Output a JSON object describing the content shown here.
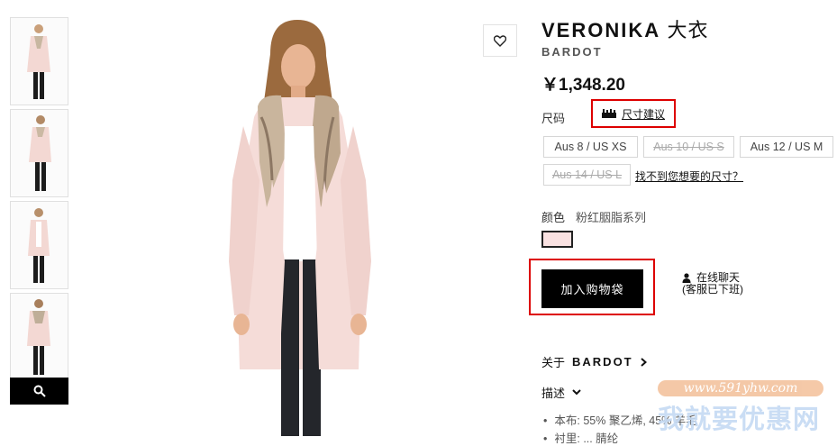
{
  "product": {
    "title_en": "VERONIKA",
    "title_cn": "大衣",
    "brand": "BARDOT",
    "price": "￥1,348.20"
  },
  "sizes": {
    "label": "尺码",
    "guide_label": "尺寸建议",
    "options": [
      {
        "label": "Aus 8 / US XS",
        "available": true
      },
      {
        "label": "Aus 10 / US S",
        "available": false
      },
      {
        "label": "Aus 12 / US M",
        "available": true
      },
      {
        "label": "Aus 14 / US L",
        "available": false
      }
    ],
    "find_size_link": "找不到您想要的尺寸？"
  },
  "color": {
    "label": "颜色",
    "value": "粉红胭脂系列",
    "swatch": "#f9e1e1"
  },
  "actions": {
    "add_to_bag": "加入购物袋",
    "chat_line1": "在线聊天",
    "chat_line2": "(客服已下班)"
  },
  "about": {
    "prefix": "关于",
    "brand": "BARDOT"
  },
  "description": {
    "label": "描述",
    "bullets": [
      "本布: 55% 聚乙烯, 45% 羊毛",
      "衬里: ... 腈纶"
    ]
  },
  "watermark": {
    "url": "www.591yhw.com",
    "text": "我就要优惠网"
  },
  "colors": {
    "accent_red": "#dd0000",
    "coat_pink": "#f5dcd8",
    "button_black": "#000000"
  }
}
